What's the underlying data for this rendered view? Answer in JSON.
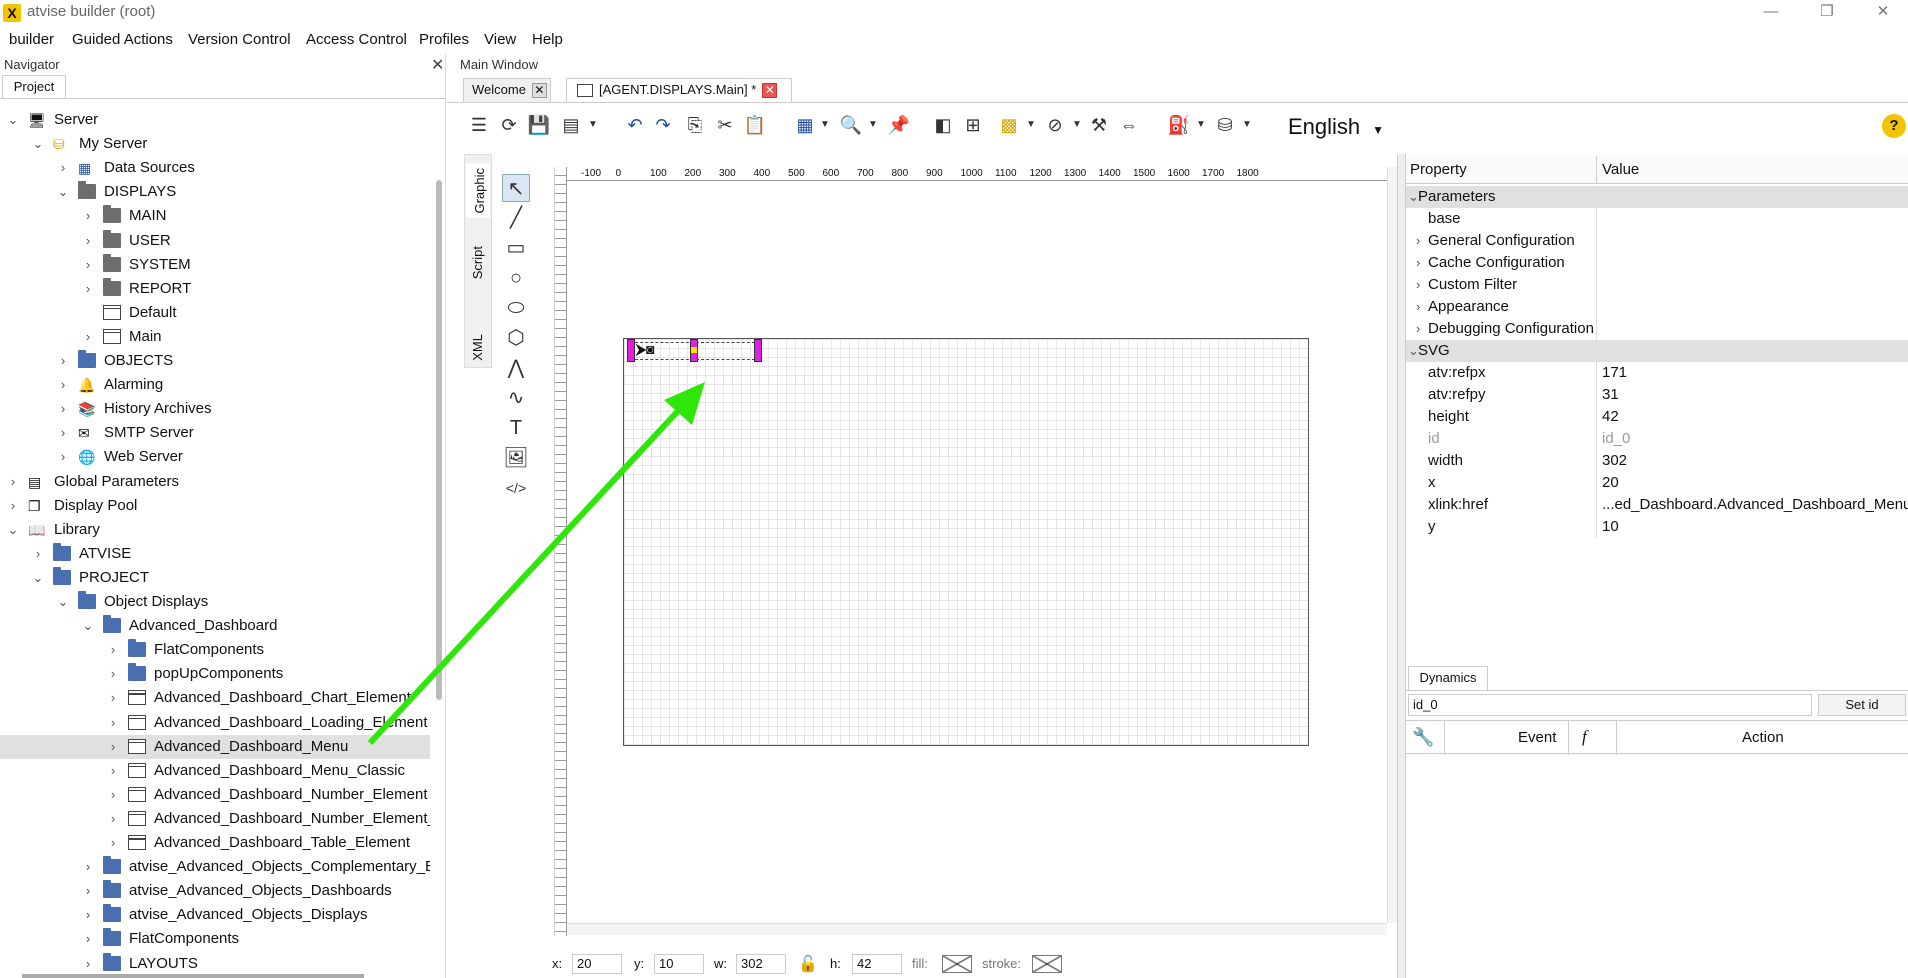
{
  "window": {
    "title": "atvise builder  (root)",
    "logo": "X"
  },
  "menubar": [
    "builder",
    "Guided Actions",
    "Version Control",
    "Access Control",
    "Profiles",
    "View",
    "Help"
  ],
  "navigator": {
    "title": "Navigator",
    "tab": "Project",
    "tree": [
      {
        "label": "Server",
        "level": 0,
        "arrow": "v",
        "icon": "server-icon"
      },
      {
        "label": "My Server",
        "level": 1,
        "arrow": "v",
        "icon": "server-node-icon"
      },
      {
        "label": "Data Sources",
        "level": 2,
        "arrow": ">",
        "icon": "grid-icon"
      },
      {
        "label": "DISPLAYS",
        "level": 2,
        "arrow": "v",
        "icon": "folder-grey"
      },
      {
        "label": "MAIN",
        "level": 3,
        "arrow": ">",
        "icon": "folder-grey"
      },
      {
        "label": "USER",
        "level": 3,
        "arrow": ">",
        "icon": "folder-grey"
      },
      {
        "label": "SYSTEM",
        "level": 3,
        "arrow": ">",
        "icon": "folder-grey"
      },
      {
        "label": "REPORT",
        "level": 3,
        "arrow": ">",
        "icon": "folder-grey"
      },
      {
        "label": "Default",
        "level": 3,
        "arrow": "",
        "icon": "doc"
      },
      {
        "label": "Main",
        "level": 3,
        "arrow": ">",
        "icon": "doc"
      },
      {
        "label": "OBJECTS",
        "level": 2,
        "arrow": ">",
        "icon": "folder"
      },
      {
        "label": "Alarming",
        "level": 2,
        "arrow": ">",
        "icon": "alarm-icon"
      },
      {
        "label": "History Archives",
        "level": 2,
        "arrow": ">",
        "icon": "archive-icon"
      },
      {
        "label": "SMTP Server",
        "level": 2,
        "arrow": ">",
        "icon": "mail-icon"
      },
      {
        "label": "Web Server",
        "level": 2,
        "arrow": ">",
        "icon": "globe-icon"
      },
      {
        "label": "Global Parameters",
        "level": 0,
        "arrow": ">",
        "icon": "params-icon"
      },
      {
        "label": "Display Pool",
        "level": 0,
        "arrow": ">",
        "icon": "pool-icon"
      },
      {
        "label": "Library",
        "level": 0,
        "arrow": "v",
        "icon": "library-icon"
      },
      {
        "label": "ATVISE",
        "level": 1,
        "arrow": ">",
        "icon": "folder"
      },
      {
        "label": "PROJECT",
        "level": 1,
        "arrow": "v",
        "icon": "folder"
      },
      {
        "label": "Object Displays",
        "level": 2,
        "arrow": "v",
        "icon": "folder"
      },
      {
        "label": "Advanced_Dashboard",
        "level": 3,
        "arrow": "v",
        "icon": "folder"
      },
      {
        "label": "FlatComponents",
        "level": 4,
        "arrow": ">",
        "icon": "folder"
      },
      {
        "label": "popUpComponents",
        "level": 4,
        "arrow": ">",
        "icon": "folder"
      },
      {
        "label": "Advanced_Dashboard_Chart_Element",
        "level": 4,
        "arrow": ">",
        "icon": "doc"
      },
      {
        "label": "Advanced_Dashboard_Loading_Element",
        "level": 4,
        "arrow": ">",
        "icon": "doc"
      },
      {
        "label": "Advanced_Dashboard_Menu",
        "level": 4,
        "arrow": ">",
        "icon": "doc",
        "selected": true
      },
      {
        "label": "Advanced_Dashboard_Menu_Classic",
        "level": 4,
        "arrow": ">",
        "icon": "doc"
      },
      {
        "label": "Advanced_Dashboard_Number_Element",
        "level": 4,
        "arrow": ">",
        "icon": "doc"
      },
      {
        "label": "Advanced_Dashboard_Number_Element_",
        "level": 4,
        "arrow": ">",
        "icon": "doc"
      },
      {
        "label": "Advanced_Dashboard_Table_Element",
        "level": 4,
        "arrow": ">",
        "icon": "doc"
      },
      {
        "label": "atvise_Advanced_Objects_Complementary_El",
        "level": 3,
        "arrow": ">",
        "icon": "folder"
      },
      {
        "label": "atvise_Advanced_Objects_Dashboards",
        "level": 3,
        "arrow": ">",
        "icon": "folder"
      },
      {
        "label": "atvise_Advanced_Objects_Displays",
        "level": 3,
        "arrow": ">",
        "icon": "folder"
      },
      {
        "label": "FlatComponents",
        "level": 3,
        "arrow": ">",
        "icon": "folder"
      },
      {
        "label": "LAYOUTS",
        "level": 3,
        "arrow": ">",
        "icon": "folder"
      }
    ]
  },
  "main": {
    "title": "Main Window",
    "tabs": [
      {
        "label": "Welcome"
      },
      {
        "label": "[AGENT.DISPLAYS.Main] *"
      }
    ],
    "language": "English",
    "side_tabs": [
      "Graphic",
      "Script",
      "XML"
    ],
    "ruler_labels": [
      "-100",
      "0",
      "100",
      "200",
      "300",
      "400",
      "500",
      "600",
      "700",
      "800",
      "900",
      "1000",
      "1100",
      "1200",
      "1300",
      "1400",
      "1500",
      "1600",
      "1700",
      "1800"
    ]
  },
  "properties": {
    "headers": {
      "property": "Property",
      "value": "Value"
    },
    "rows": [
      {
        "name": "Parameters",
        "value": "",
        "group": true,
        "arrow": "v"
      },
      {
        "name": "base",
        "value": ""
      },
      {
        "name": "General Configuration",
        "value": "",
        "arrow": ">"
      },
      {
        "name": "Cache Configuration",
        "value": "",
        "arrow": ">"
      },
      {
        "name": "Custom Filter",
        "value": "",
        "arrow": ">"
      },
      {
        "name": "Appearance",
        "value": "",
        "arrow": ">"
      },
      {
        "name": "Debugging Configuration",
        "value": "",
        "arrow": ">"
      },
      {
        "name": "SVG",
        "value": "",
        "group": true,
        "arrow": "v"
      },
      {
        "name": "atv:refpx",
        "value": "171"
      },
      {
        "name": "atv:refpy",
        "value": "31"
      },
      {
        "name": "height",
        "value": "42"
      },
      {
        "name": "id",
        "value": "id_0",
        "muted": true
      },
      {
        "name": "width",
        "value": "302"
      },
      {
        "name": "x",
        "value": "20"
      },
      {
        "name": "xlink:href",
        "value": "...ed_Dashboard.Advanced_Dashboard_Menu"
      },
      {
        "name": "y",
        "value": "10"
      }
    ]
  },
  "dynamics": {
    "tab": "Dynamics",
    "id_value": "id_0",
    "set_id": "Set id",
    "col_event": "Event",
    "col_f": "f",
    "col_action": "Action"
  },
  "coords": {
    "x_label": "x:",
    "x": "20",
    "y_label": "y:",
    "y": "10",
    "w_label": "w:",
    "w": "302",
    "h_label": "h:",
    "h": "42",
    "fill_label": "fill:",
    "stroke_label": "stroke:"
  },
  "colors": {
    "accent_arrow": "#2ee60a",
    "handle": "#e020e0",
    "selection": "#e0e0e0"
  }
}
